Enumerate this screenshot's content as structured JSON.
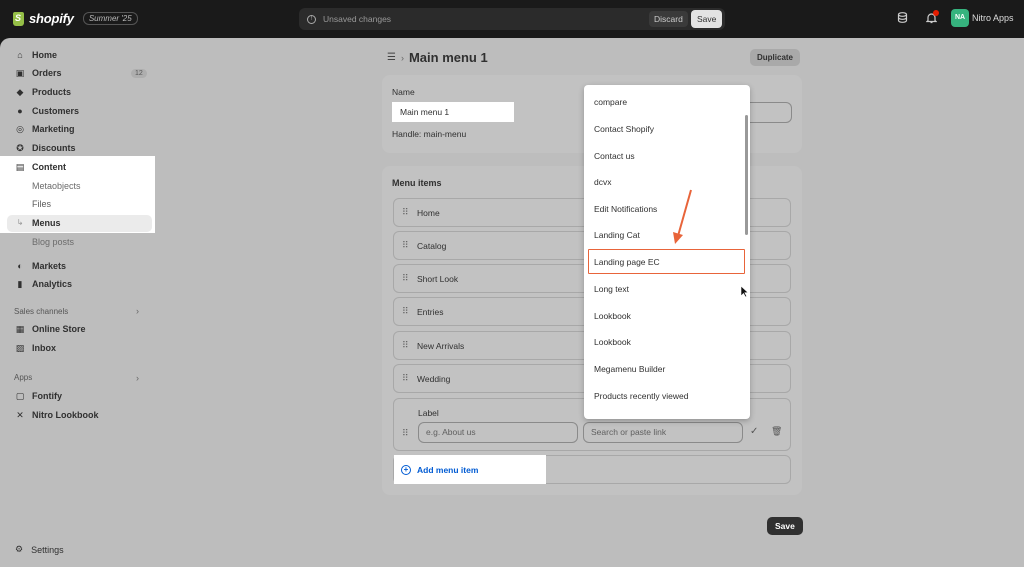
{
  "topbar": {
    "brand": "shopify",
    "season": "Summer '25",
    "unsaved": "Unsaved changes",
    "discard": "Discard",
    "save": "Save",
    "avatar_initials": "NA",
    "store": "Nitro Apps"
  },
  "sidebar": {
    "items": [
      {
        "label": "Home",
        "icon": "home-icon"
      },
      {
        "label": "Orders",
        "icon": "orders-icon",
        "badge": "12"
      },
      {
        "label": "Products",
        "icon": "tag-icon"
      },
      {
        "label": "Customers",
        "icon": "person-icon"
      },
      {
        "label": "Marketing",
        "icon": "target-icon"
      },
      {
        "label": "Discounts",
        "icon": "discount-icon"
      },
      {
        "label": "Content",
        "icon": "content-icon"
      }
    ],
    "content_sub": [
      "Metaobjects",
      "Files",
      "Menus",
      "Blog posts"
    ],
    "items2": [
      {
        "label": "Markets",
        "icon": "globe-icon"
      },
      {
        "label": "Analytics",
        "icon": "chart-icon"
      }
    ],
    "sales_channels": "Sales channels",
    "channels": [
      {
        "label": "Online Store",
        "icon": "store-icon"
      },
      {
        "label": "Inbox",
        "icon": "inbox-icon"
      }
    ],
    "apps_heading": "Apps",
    "apps": [
      {
        "label": "Fontify",
        "icon": "fontify-icon"
      },
      {
        "label": "Nitro Lookbook",
        "icon": "lookbook-icon"
      }
    ],
    "settings": "Settings"
  },
  "page": {
    "title": "Main menu 1",
    "duplicate": "Duplicate",
    "name_label": "Name",
    "name_value": "Main menu 1",
    "handle": "Handle: main-menu",
    "menu_items_title": "Menu items",
    "menu_items": [
      "Home",
      "Catalog",
      "Short Look",
      "Entries",
      "New Arrivals",
      "Wedding"
    ],
    "edit_label": "Label",
    "label_placeholder": "e.g. About us",
    "link_placeholder": "Search or paste link",
    "add_item": "Add menu item",
    "save": "Save"
  },
  "dropdown": {
    "items": [
      "compare",
      "Contact Shopify",
      "Contact us",
      "dcvx",
      "Edit Notifications",
      "Landing Cat",
      "Landing page EC",
      "Long text",
      "Lookbook",
      "Lookbook",
      "Megamenu Builder",
      "Products recently viewed"
    ],
    "highlighted": "Landing page EC",
    "highlight_color": "#e8643a"
  }
}
